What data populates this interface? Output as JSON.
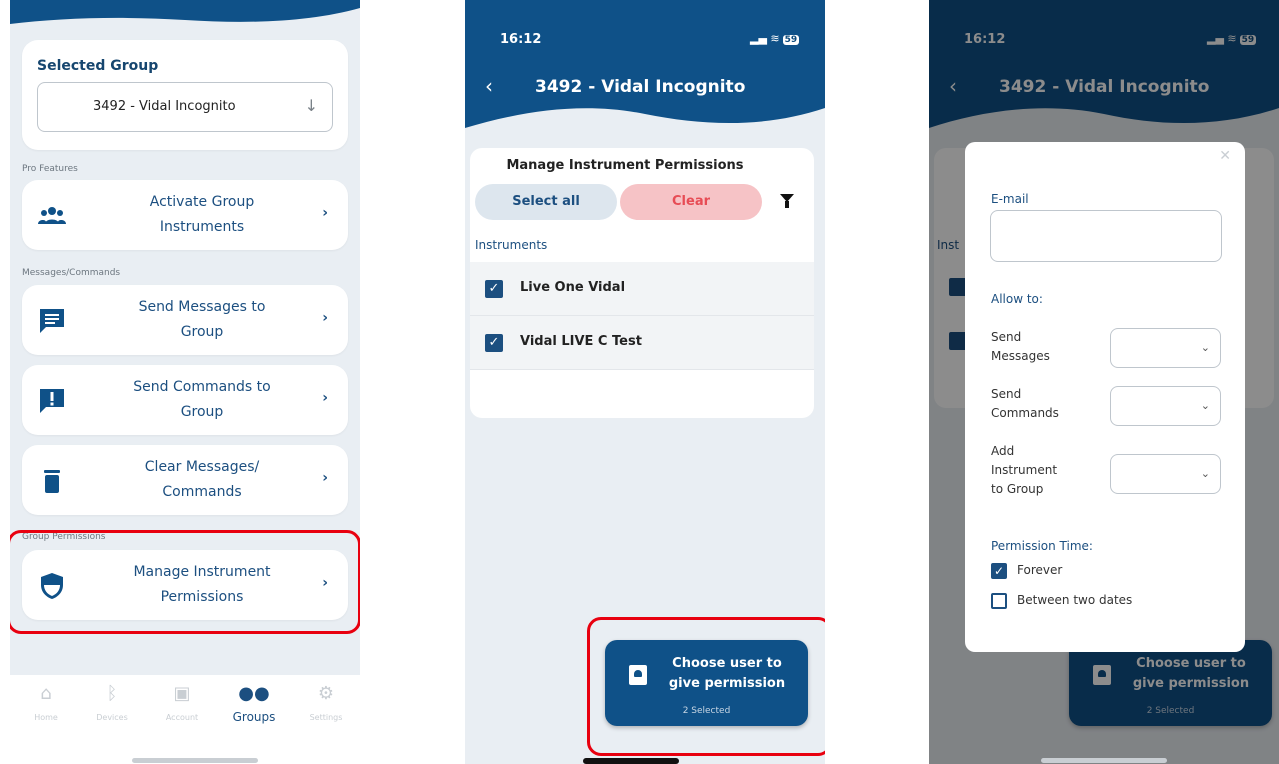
{
  "phone1": {
    "selected_group": {
      "title": "Selected Group",
      "value": "3492 - Vidal Incognito"
    },
    "sections": {
      "pro": "Pro Features",
      "messages": "Messages/Commands",
      "permissions": "Group Permissions"
    },
    "menu": [
      {
        "label_line1": "Activate Group",
        "label_line2": "Instruments",
        "icon": "group-icon"
      },
      {
        "label_line1": "Send Messages to",
        "label_line2": "Group",
        "icon": "message-icon"
      },
      {
        "label_line1": "Send Commands to",
        "label_line2": "Group",
        "icon": "command-icon"
      },
      {
        "label_line1": "Clear Messages/",
        "label_line2": "Commands",
        "icon": "trash-icon"
      },
      {
        "label_line1": "Manage Instrument",
        "label_line2": "Permissions",
        "icon": "shield-icon"
      }
    ],
    "tabs": [
      {
        "label": "Home",
        "icon": "home-icon"
      },
      {
        "label": "Devices",
        "icon": "bluetooth-icon"
      },
      {
        "label": "Account",
        "icon": "account-icon"
      },
      {
        "label": "Groups",
        "icon": "groups-icon",
        "active": true
      },
      {
        "label": "Settings",
        "icon": "gear-icon"
      }
    ]
  },
  "phone2": {
    "status": {
      "time": "16:12",
      "battery": "59"
    },
    "header_title": "3492 - Vidal Incognito",
    "card_title": "Manage Instrument Permissions",
    "select_all": "Select all",
    "clear": "Clear",
    "instruments_label": "Instruments",
    "instruments": [
      {
        "name": "Live One Vidal",
        "checked": true
      },
      {
        "name": "Vidal LIVE C Test",
        "checked": true
      }
    ],
    "choose_button": {
      "line1": "Choose user to",
      "line2": "give permission",
      "sub": "2 Selected"
    }
  },
  "phone3": {
    "status": {
      "time": "16:12",
      "battery": "59"
    },
    "header_title": "3492 - Vidal Incognito",
    "bg_partial_label": "Inst",
    "modal": {
      "email_label": "E-mail",
      "email_value": "",
      "allow_label": "Allow to:",
      "send_messages": [
        "Send",
        "Messages"
      ],
      "send_commands": [
        "Send",
        "Commands"
      ],
      "add_instrument": [
        "Add",
        "Instrument",
        "to Group"
      ],
      "permission_time": "Permission Time:",
      "forever": "Forever",
      "between": "Between two dates"
    },
    "choose_button": {
      "line1": "Choose user to",
      "line2": "give permission",
      "sub": "2 Selected"
    }
  },
  "colors": {
    "primary": "#0f5188",
    "highlight": "#e8000f",
    "clear_bg": "#f6c3c6"
  }
}
